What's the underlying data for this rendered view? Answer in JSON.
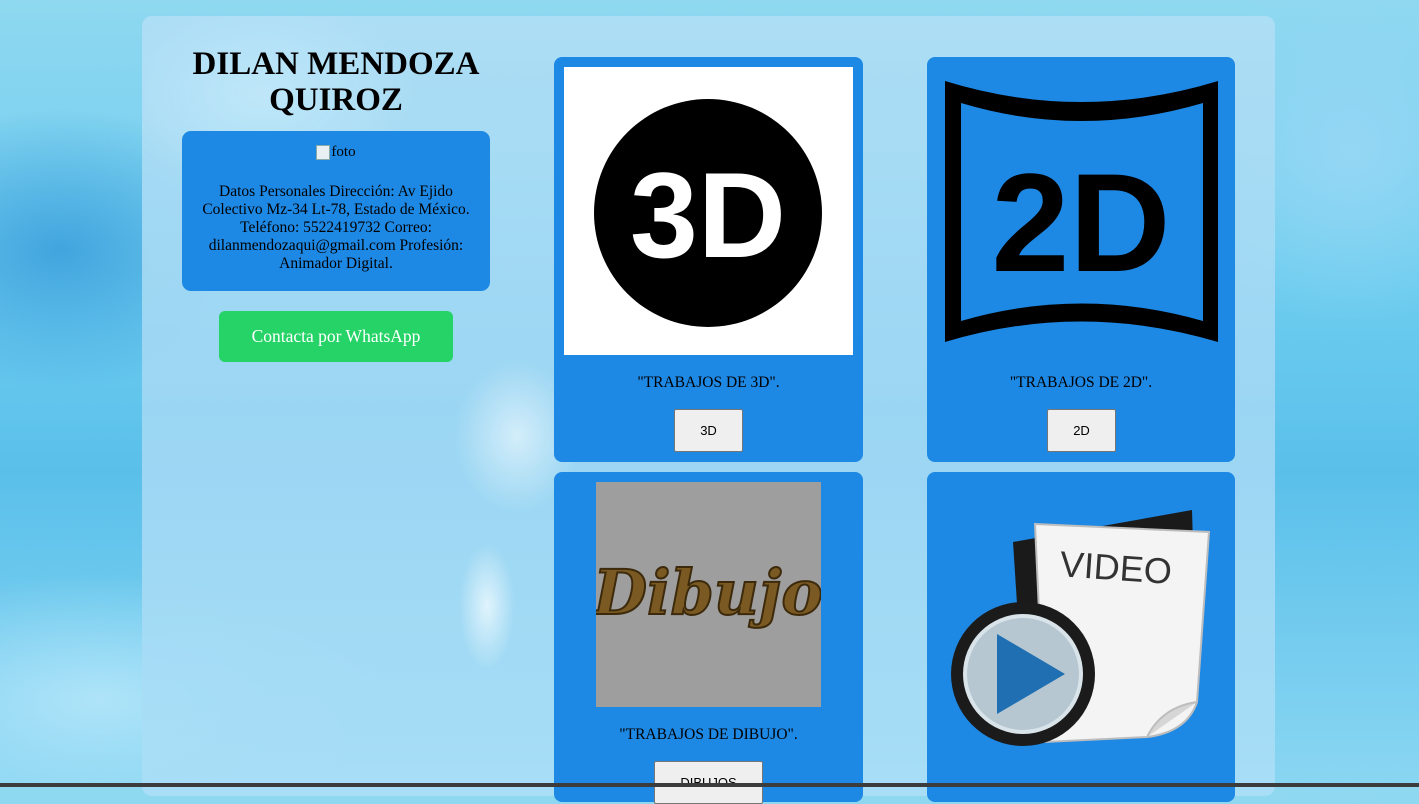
{
  "profile": {
    "name": "DILAN MENDOZA QUIROZ",
    "photo_alt": "foto",
    "details": "Datos Personales Dirección: Av Ejido Colectivo Mz-34 Lt-78, Estado de México. Teléfono: 5522419732 Correo: dilanmendozaqui@gmail.com Profesión: Animador Digital.",
    "whatsapp_label": "Contacta por WhatsApp"
  },
  "cards": [
    {
      "image_text": "3D",
      "caption": "\"TRABAJOS DE 3D\".",
      "button": "3D"
    },
    {
      "image_text": "2D",
      "caption": "\"TRABAJOS DE 2D\".",
      "button": "2D"
    },
    {
      "image_text": "Dibujo",
      "caption": "\"TRABAJOS DE DIBUJO\".",
      "button": "DIBUJOS"
    },
    {
      "image_text": "VIDEO",
      "caption": "",
      "button": ""
    }
  ],
  "colors": {
    "card_blue": "#1e88e5",
    "whatsapp_green": "#25d366"
  }
}
